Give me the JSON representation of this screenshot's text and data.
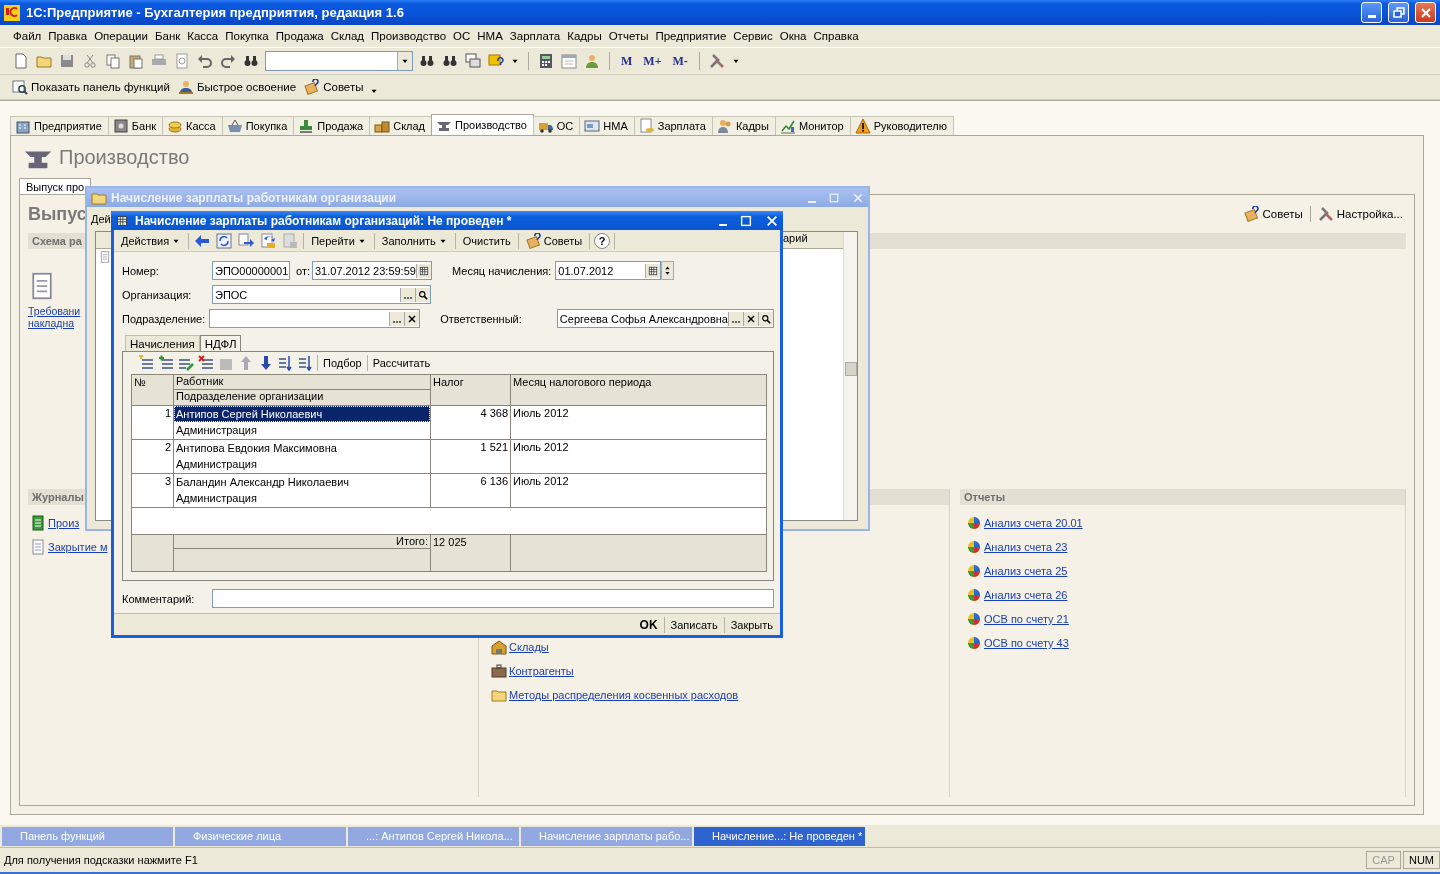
{
  "window": {
    "title": "1С:Предприятие - Бухгалтерия предприятия, редакция 1.6"
  },
  "menu": [
    "Файл",
    "Правка",
    "Операции",
    "Банк",
    "Касса",
    "Покупка",
    "Продажа",
    "Склад",
    "Производство",
    "ОС",
    "НМА",
    "Зарплата",
    "Кадры",
    "Отчеты",
    "Предприятие",
    "Сервис",
    "Окна",
    "Справка"
  ],
  "toolbar": {
    "memory_buttons": [
      "M",
      "M+",
      "M-"
    ]
  },
  "toolbar2": [
    "Показать панель функций",
    "Быстрое освоение",
    "Советы"
  ],
  "function_tabs": [
    {
      "label": "Предприятие",
      "selected": false
    },
    {
      "label": "Банк",
      "selected": false
    },
    {
      "label": "Касса",
      "selected": false
    },
    {
      "label": "Покупка",
      "selected": false
    },
    {
      "label": "Продажа",
      "selected": false
    },
    {
      "label": "Склад",
      "selected": false
    },
    {
      "label": "Производство",
      "selected": true
    },
    {
      "label": "ОС",
      "selected": false
    },
    {
      "label": "НМА",
      "selected": false
    },
    {
      "label": "Зарплата",
      "selected": false
    },
    {
      "label": "Кадры",
      "selected": false
    },
    {
      "label": "Монитор",
      "selected": false
    },
    {
      "label": "Руководителю",
      "selected": false
    }
  ],
  "panel": {
    "title": "Производство",
    "subtabs": [
      {
        "label": "Выпуск про",
        "selected": true
      }
    ],
    "section_title": "Выпус",
    "tips": "Советы",
    "settings": "Настройка...",
    "schema_title": "Схема ра",
    "schema_item": [
      "Требовани",
      "накладна"
    ],
    "journals": {
      "title": "Журналы",
      "items": [
        "Произ",
        "Закрытие м"
      ]
    },
    "catalogs": {
      "items": [
        "Склады",
        "Контрагенты",
        "Методы распределения косвенных расходов"
      ]
    },
    "reports": {
      "title": "Отчеты",
      "items": [
        "Анализ счета 20.01",
        "Анализ счета 23",
        "Анализ счета 25",
        "Анализ счета 26",
        "ОСВ по счету 21",
        "ОСВ по счету 43"
      ]
    }
  },
  "background_window": {
    "title": "Начисление зарплаты работникам организации",
    "toolbar_label": "Дей",
    "column_label": "арий"
  },
  "document": {
    "title": "Начисление зарплаты работникам организаций: Не проведен *",
    "toolbar": [
      {
        "kind": "menu",
        "label": "Действия"
      },
      {
        "kind": "menu",
        "label": "Перейти"
      },
      {
        "kind": "menu",
        "label": "Заполнить"
      },
      {
        "kind": "button",
        "label": "Очистить"
      },
      {
        "kind": "tips",
        "label": "Советы"
      },
      {
        "kind": "help",
        "label": "?"
      }
    ],
    "number": {
      "label": "Номер:",
      "value": "ЭПО00000001"
    },
    "date": {
      "label": "от:",
      "value": "31.07.2012 23:59:59"
    },
    "month": {
      "label": "Месяц начисления:",
      "value": "01.07.2012"
    },
    "organization": {
      "label": "Организация:",
      "value": "ЭПОС"
    },
    "department": {
      "label": "Подразделение:"
    },
    "responsible": {
      "label": "Ответственный:",
      "value": "Сергеева Софья Александровна"
    },
    "tabs": [
      {
        "label": "Начисления",
        "selected": false
      },
      {
        "label": "НДФЛ",
        "selected": true
      }
    ],
    "table_toolbar": [
      "Подбор",
      "Рассчитать"
    ],
    "table": {
      "columns": [
        "№",
        "Работник",
        "Подразделение организации",
        "Налог",
        "Месяц налогового периода"
      ],
      "rows": [
        {
          "n": "1",
          "employee": "Антипов Сергей Николаевич",
          "department": "Администрация",
          "tax": "4 368",
          "month": "Июль 2012",
          "selected": true
        },
        {
          "n": "2",
          "employee": "Антипова Евдокия  Максимовна",
          "department": "Администрация",
          "tax": "1 521",
          "month": "Июль 2012",
          "selected": false
        },
        {
          "n": "3",
          "employee": "Баландин Александр Николаевич",
          "department": "Администрация",
          "tax": "6 136",
          "month": "Июль 2012",
          "selected": false
        }
      ],
      "total_label": "Итого:",
      "total_tax": "12 025"
    },
    "comment": {
      "label": "Комментарий:"
    },
    "buttons": [
      {
        "kind": "default",
        "label": "OK"
      },
      {
        "kind": "normal",
        "label": "Записать"
      },
      {
        "kind": "normal",
        "label": "Закрыть"
      }
    ]
  },
  "window_bar": [
    {
      "label": "Панель функций",
      "selected": false
    },
    {
      "label": "Физические лица",
      "selected": false
    },
    {
      "label": "...: Антипов Сергей Никола...",
      "selected": false
    },
    {
      "label": "Начисление зарплаты рабо...",
      "selected": false
    },
    {
      "label": "Начисление...: Не проведен *",
      "selected": true
    }
  ],
  "status_bar": {
    "hint": "Для получения подсказки нажмите F1",
    "indicators": [
      {
        "label": "CAP",
        "on": false
      },
      {
        "label": "NUM",
        "on": true
      }
    ]
  }
}
